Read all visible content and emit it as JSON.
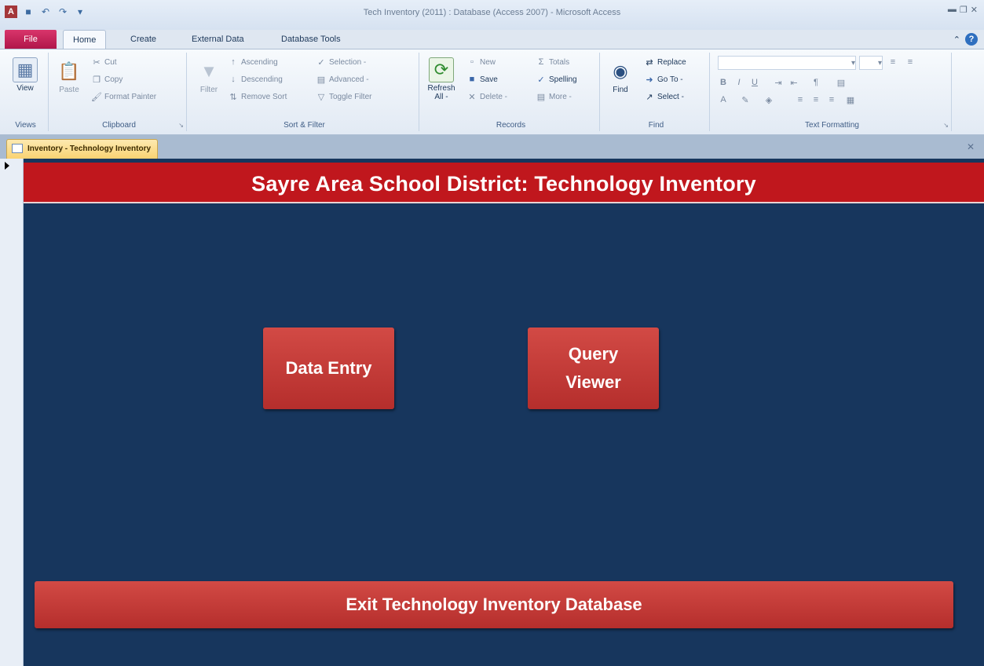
{
  "window": {
    "title": "Tech Inventory (2011) : Database (Access 2007) - Microsoft Access",
    "app_icon_letter": "A"
  },
  "tabs": [
    "File",
    "Home",
    "Create",
    "External Data",
    "Database Tools"
  ],
  "ribbon": {
    "views": {
      "view": "View",
      "label": "Views"
    },
    "clipboard": {
      "paste": "Paste",
      "cut": "Cut",
      "copy": "Copy",
      "format_painter": "Format Painter",
      "label": "Clipboard"
    },
    "sort_filter": {
      "filter": "Filter",
      "ascending": "Ascending",
      "descending": "Descending",
      "remove_sort": "Remove Sort",
      "selection": "Selection -",
      "advanced": "Advanced -",
      "toggle_filter": "Toggle Filter",
      "label": "Sort & Filter"
    },
    "records": {
      "refresh": "Refresh",
      "refresh_all": "All -",
      "new": "New",
      "save": "Save",
      "delete": "Delete -",
      "totals": "Totals",
      "spelling": "Spelling",
      "more": "More -",
      "label": "Records"
    },
    "find": {
      "find": "Find",
      "replace": "Replace",
      "goto": "Go To -",
      "select": "Select -",
      "label": "Find"
    },
    "text_formatting": {
      "label": "Text Formatting"
    }
  },
  "document_tab": "Inventory - Technology Inventory",
  "form": {
    "header": "Sayre Area School District: Technology Inventory",
    "data_entry": "Data Entry",
    "query_line1": "Query",
    "query_line2": "Viewer",
    "exit": "Exit Technology Inventory Database"
  },
  "colors": {
    "form_bg": "#17365d",
    "header_bg": "#c0171d",
    "button_bg": "#c13a38"
  }
}
